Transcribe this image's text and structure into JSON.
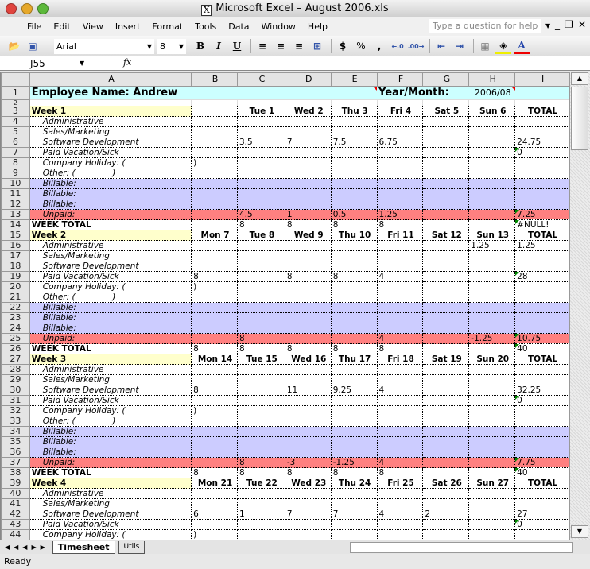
{
  "window": {
    "title": "Microsoft Excel – August 2006.xls",
    "app_icon": "X"
  },
  "menu": [
    "File",
    "Edit",
    "View",
    "Insert",
    "Format",
    "Tools",
    "Data",
    "Window",
    "Help"
  ],
  "help_placeholder": "Type a question for help",
  "toolbar": {
    "font": "Arial",
    "size": "8",
    "bold": "B",
    "italic": "I",
    "underline": "U",
    "currency": "$",
    "percent": "%",
    "comma": ","
  },
  "formula_bar": {
    "cell_ref": "J55",
    "fx": "fx",
    "value": ""
  },
  "columns": [
    "A",
    "B",
    "C",
    "D",
    "E",
    "F",
    "G",
    "H",
    "I"
  ],
  "header": {
    "employee": "Employee Name: Andrew",
    "year_month_label": "Year/Month:",
    "year_month": "2006/08"
  },
  "colors": {
    "week_header": "#ffffcc",
    "billable": "#ccccff",
    "unpaid": "#ff8080",
    "title_row": "#ccffff"
  },
  "weeks": [
    {
      "label": "Week 1",
      "days": [
        "",
        "Tue 1",
        "Wed 2",
        "Thu 3",
        "Fri 4",
        "Sat 5",
        "Sun 6",
        "TOTAL"
      ],
      "rows": [
        {
          "label": "Administrative",
          "values": [
            "",
            "",
            "",
            "",
            "",
            "",
            "",
            ""
          ]
        },
        {
          "label": "Sales/Marketing",
          "values": [
            "",
            "",
            "",
            "",
            "",
            "",
            "",
            ""
          ]
        },
        {
          "label": "Software Development",
          "values": [
            "",
            "3.5",
            "7",
            "7.5",
            "6.75",
            "",
            "",
            "24.75"
          ]
        },
        {
          "label": "Paid Vacation/Sick",
          "values": [
            "",
            "",
            "",
            "",
            "",
            "",
            "",
            "0"
          ]
        },
        {
          "label": "Company Holiday: (",
          "values": [
            ")",
            "",
            "",
            "",
            "",
            "",
            "",
            ""
          ]
        },
        {
          "label": "Other: (              )",
          "values": [
            "",
            "",
            "",
            "",
            "",
            "",
            "",
            ""
          ]
        },
        {
          "label": "Billable:",
          "values": [
            "",
            "",
            "",
            "",
            "",
            "",
            "",
            ""
          ]
        },
        {
          "label": "Billable:",
          "values": [
            "",
            "",
            "",
            "",
            "",
            "",
            "",
            ""
          ]
        },
        {
          "label": "Billable:",
          "values": [
            "",
            "",
            "",
            "",
            "",
            "",
            "",
            ""
          ]
        },
        {
          "label": "Unpaid:",
          "values": [
            "",
            "4.5",
            "1",
            "0.5",
            "1.25",
            "",
            "",
            "7.25"
          ]
        },
        {
          "label": "WEEK TOTAL",
          "values": [
            "",
            "8",
            "8",
            "8",
            "8",
            "",
            "",
            "#NULL!"
          ]
        }
      ]
    },
    {
      "label": "Week 2",
      "days": [
        "Mon 7",
        "Tue 8",
        "Wed 9",
        "Thu 10",
        "Fri 11",
        "Sat 12",
        "Sun 13",
        "TOTAL"
      ],
      "rows": [
        {
          "label": "Administrative",
          "values": [
            "",
            "",
            "",
            "",
            "",
            "",
            "1.25",
            "1.25"
          ]
        },
        {
          "label": "Sales/Marketing",
          "values": [
            "",
            "",
            "",
            "",
            "",
            "",
            "",
            ""
          ]
        },
        {
          "label": "Software Development",
          "values": [
            "",
            "",
            "",
            "",
            "",
            "",
            "",
            ""
          ]
        },
        {
          "label": "Paid Vacation/Sick",
          "values": [
            "8",
            "",
            "8",
            "8",
            "4",
            "",
            "",
            "28"
          ]
        },
        {
          "label": "Company Holiday: (",
          "values": [
            ")",
            "",
            "",
            "",
            "",
            "",
            "",
            ""
          ]
        },
        {
          "label": "Other: (              )",
          "values": [
            "",
            "",
            "",
            "",
            "",
            "",
            "",
            ""
          ]
        },
        {
          "label": "Billable:",
          "values": [
            "",
            "",
            "",
            "",
            "",
            "",
            "",
            ""
          ]
        },
        {
          "label": "Billable:",
          "values": [
            "",
            "",
            "",
            "",
            "",
            "",
            "",
            ""
          ]
        },
        {
          "label": "Billable:",
          "values": [
            "",
            "",
            "",
            "",
            "",
            "",
            "",
            ""
          ]
        },
        {
          "label": "Unpaid:",
          "values": [
            "",
            "8",
            "",
            "",
            "4",
            "",
            "-1.25",
            "10.75"
          ]
        },
        {
          "label": "WEEK TOTAL",
          "values": [
            "8",
            "8",
            "8",
            "8",
            "8",
            "",
            "",
            "40"
          ]
        }
      ]
    },
    {
      "label": "Week 3",
      "days": [
        "Mon 14",
        "Tue 15",
        "Wed 16",
        "Thu 17",
        "Fri 18",
        "Sat 19",
        "Sun 20",
        "TOTAL"
      ],
      "rows": [
        {
          "label": "Administrative",
          "values": [
            "",
            "",
            "",
            "",
            "",
            "",
            "",
            ""
          ]
        },
        {
          "label": "Sales/Marketing",
          "values": [
            "",
            "",
            "",
            "",
            "",
            "",
            "",
            ""
          ]
        },
        {
          "label": "Software Development",
          "values": [
            "8",
            "",
            "11",
            "9.25",
            "4",
            "",
            "",
            "32.25"
          ]
        },
        {
          "label": "Paid Vacation/Sick",
          "values": [
            "",
            "",
            "",
            "",
            "",
            "",
            "",
            "0"
          ]
        },
        {
          "label": "Company Holiday: (",
          "values": [
            ")",
            "",
            "",
            "",
            "",
            "",
            "",
            ""
          ]
        },
        {
          "label": "Other: (              )",
          "values": [
            "",
            "",
            "",
            "",
            "",
            "",
            "",
            ""
          ]
        },
        {
          "label": "Billable:",
          "values": [
            "",
            "",
            "",
            "",
            "",
            "",
            "",
            ""
          ]
        },
        {
          "label": "Billable:",
          "values": [
            "",
            "",
            "",
            "",
            "",
            "",
            "",
            ""
          ]
        },
        {
          "label": "Billable:",
          "values": [
            "",
            "",
            "",
            "",
            "",
            "",
            "",
            ""
          ]
        },
        {
          "label": "Unpaid:",
          "values": [
            "",
            "8",
            "-3",
            "-1.25",
            "4",
            "",
            "",
            "7.75"
          ]
        },
        {
          "label": "WEEK TOTAL",
          "values": [
            "8",
            "8",
            "8",
            "8",
            "8",
            "",
            "",
            "40"
          ]
        }
      ]
    },
    {
      "label": "Week 4",
      "days": [
        "Mon 21",
        "Tue 22",
        "Wed 23",
        "Thu 24",
        "Fri 25",
        "Sat 26",
        "Sun 27",
        "TOTAL"
      ],
      "rows": [
        {
          "label": "Administrative",
          "values": [
            "",
            "",
            "",
            "",
            "",
            "",
            "",
            ""
          ]
        },
        {
          "label": "Sales/Marketing",
          "values": [
            "",
            "",
            "",
            "",
            "",
            "",
            "",
            ""
          ]
        },
        {
          "label": "Software Development",
          "values": [
            "6",
            "1",
            "7",
            "7",
            "4",
            "2",
            "",
            "27"
          ]
        },
        {
          "label": "Paid Vacation/Sick",
          "values": [
            "",
            "",
            "",
            "",
            "",
            "",
            "",
            "0"
          ]
        },
        {
          "label": "Company Holiday: (",
          "values": [
            ")",
            "",
            "",
            "",
            "",
            "",
            "",
            ""
          ]
        }
      ]
    }
  ],
  "sheet_tabs": [
    "Timesheet",
    "Utils"
  ],
  "status": "Ready"
}
